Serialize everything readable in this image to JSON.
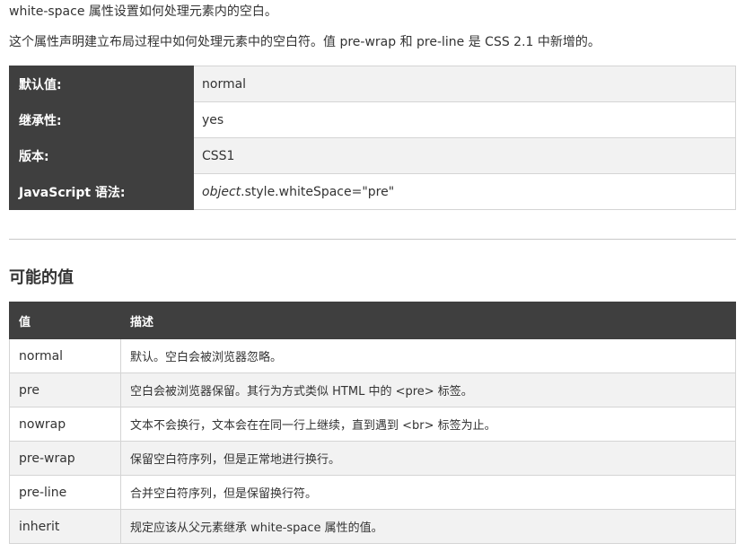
{
  "intro": {
    "line1": "white-space 属性设置如何处理元素内的空白。",
    "line2": "这个属性声明建立布局过程中如何处理元素中的空白符。值 pre-wrap 和 pre-line 是 CSS 2.1 中新增的。"
  },
  "props": [
    {
      "key": "默认值:",
      "value": "normal"
    },
    {
      "key": "继承性:",
      "value": "yes"
    },
    {
      "key": "版本:",
      "value": "CSS1"
    },
    {
      "key": "JavaScript 语法:",
      "value_em": "object",
      "value": ".style.whiteSpace=\"pre\""
    }
  ],
  "section_title": "可能的值",
  "values_table": {
    "headers": [
      "值",
      "描述"
    ],
    "rows": [
      {
        "value": "normal",
        "desc": "默认。空白会被浏览器忽略。"
      },
      {
        "value": "pre",
        "desc": "空白会被浏览器保留。其行为方式类似 HTML 中的 <pre> 标签。"
      },
      {
        "value": "nowrap",
        "desc": "文本不会换行，文本会在在同一行上继续，直到遇到 <br> 标签为止。"
      },
      {
        "value": "pre-wrap",
        "desc": "保留空白符序列，但是正常地进行换行。"
      },
      {
        "value": "pre-line",
        "desc": "合并空白符序列，但是保留换行符。"
      },
      {
        "value": "inherit",
        "desc": "规定应该从父元素继承 white-space 属性的值。"
      }
    ]
  }
}
